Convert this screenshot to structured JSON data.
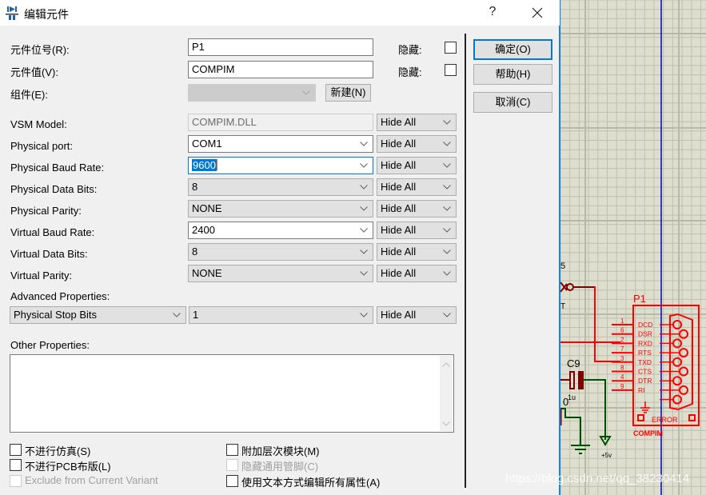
{
  "window": {
    "title": "编辑元件",
    "help_glyph": "?",
    "close_glyph": "×"
  },
  "fields": {
    "part_reference_label": "元件位号(R):",
    "part_reference_value": "P1",
    "part_value_label": "元件值(V):",
    "part_value_value": "COMPIM",
    "element_label": "组件(E):",
    "element_value": "",
    "new_button": "新建(N)",
    "hidden_label_1": "隐藏:",
    "hidden_label_2": "隐藏:",
    "hidden_checked_1": false,
    "hidden_checked_2": false
  },
  "properties": [
    {
      "label": "VSM Model:",
      "value": "COMPIM.DLL",
      "kind": "readonly",
      "visibility": "Hide All"
    },
    {
      "label": "Physical port:",
      "value": "COM1",
      "kind": "white",
      "visibility": "Hide All"
    },
    {
      "label": "Physical Baud Rate:",
      "value": "9600",
      "kind": "focused",
      "visibility": "Hide All"
    },
    {
      "label": "Physical Data Bits:",
      "value": "8",
      "kind": "gray",
      "visibility": "Hide All"
    },
    {
      "label": "Physical Parity:",
      "value": "NONE",
      "kind": "gray",
      "visibility": "Hide All"
    },
    {
      "label": "Virtual Baud Rate:",
      "value": "2400",
      "kind": "white",
      "visibility": "Hide All"
    },
    {
      "label": "Virtual Data Bits:",
      "value": "8",
      "kind": "gray",
      "visibility": "Hide All"
    },
    {
      "label": "Virtual Parity:",
      "value": "NONE",
      "kind": "gray",
      "visibility": "Hide All"
    }
  ],
  "advanced": {
    "label": "Advanced Properties:",
    "property": "Physical Stop Bits",
    "value": "1",
    "visibility": "Hide All"
  },
  "other_properties": {
    "label": "Other Properties:",
    "value": ""
  },
  "buttons": {
    "ok": "确定(O)",
    "help": "帮助(H)",
    "cancel": "取消(C)"
  },
  "options": [
    {
      "label": "不进行仿真(S)",
      "checked": false,
      "disabled": false
    },
    {
      "label": "不进行PCB布版(L)",
      "checked": false,
      "disabled": false
    },
    {
      "label": "Exclude from Current Variant",
      "checked": false,
      "disabled": true
    },
    {
      "label": "附加层次模块(M)",
      "checked": false,
      "disabled": false
    },
    {
      "label": "隐藏通用管脚(C)",
      "checked": false,
      "disabled": true
    },
    {
      "label": "使用文本方式编辑所有属性(A)",
      "checked": false,
      "disabled": false
    }
  ],
  "schematic": {
    "component_ref": "P1",
    "component_name": "COMPIM",
    "pins": [
      {
        "num": "1",
        "name": "DCD"
      },
      {
        "num": "6",
        "name": "DSR"
      },
      {
        "num": "2",
        "name": "RXD"
      },
      {
        "num": "7",
        "name": "RTS"
      },
      {
        "num": "3",
        "name": "TXD"
      },
      {
        "num": "8",
        "name": "CTS"
      },
      {
        "num": "4",
        "name": "DTR"
      },
      {
        "num": "9",
        "name": "RI"
      }
    ],
    "error_label": "ERROR",
    "capacitor_ref": "C9",
    "capacitor_value_fragment": "1u",
    "side_text_fragment": "0",
    "power_label": "+5v",
    "fragment_5": "5",
    "fragment_t": "T",
    "colors": {
      "wire": "#ff0000",
      "component": "#ff0000",
      "ground_wire": "#005000",
      "dark_red": "#800000",
      "grid_bg": "#dedecf",
      "grid_line": "#c0c0b0",
      "axis": "#0000c0"
    }
  },
  "watermark": "https://blog.csdn.net/qq_38230414"
}
